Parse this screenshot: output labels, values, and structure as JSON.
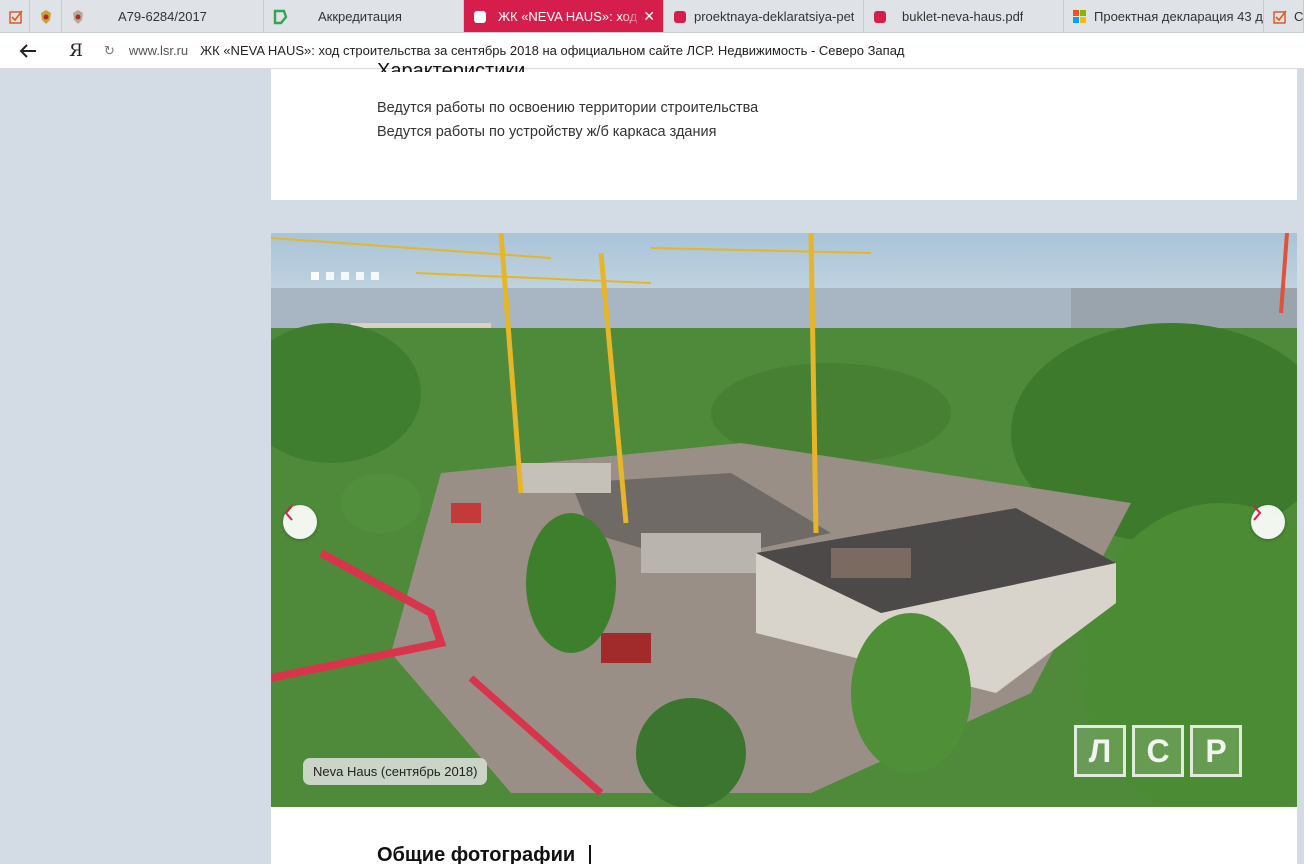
{
  "browser": {
    "tabs": [
      {
        "label": "",
        "icon": "tasks-icon"
      },
      {
        "label": "",
        "icon": "coat-of-arms-icon"
      },
      {
        "label": "А79-6284/2017",
        "icon": "coat-of-arms-icon"
      },
      {
        "label": "Аккредитация",
        "icon": "green-logo-icon"
      },
      {
        "label": "ЖК «NEVA HAUS»: ход строительства",
        "icon": "lsr-icon",
        "active": true
      },
      {
        "label": "proektnaya-deklaratsiya-pet",
        "icon": "pdf-icon"
      },
      {
        "label": "buklet-neva-haus.pdf",
        "icon": "pdf-icon"
      },
      {
        "label": "Проектная декларация 43 д",
        "icon": "windows-icon"
      },
      {
        "label": "СП",
        "icon": "tasks-icon"
      }
    ],
    "address": {
      "domain": "www.lsr.ru",
      "title": "ЖК «NEVA HAUS»: ход строительства за сентябрь 2018 на официальном сайте ЛСР. Недвижимость - Северо Запад"
    },
    "yandex_label": "Я"
  },
  "content": {
    "cut_heading": "Характеристики",
    "works": [
      "Ведутся работы по освоению территории строительства",
      "Ведутся работы по устройству ж/б каркаса здания"
    ],
    "slider": {
      "caption": "Neva Haus (сентябрь 2018)",
      "dots_count": 5,
      "watermark": [
        "Л",
        "С",
        "Р"
      ]
    },
    "section_title": "Общие фотографии"
  },
  "colors": {
    "accent": "#d51e4b",
    "page_bg": "#d3dce4"
  }
}
